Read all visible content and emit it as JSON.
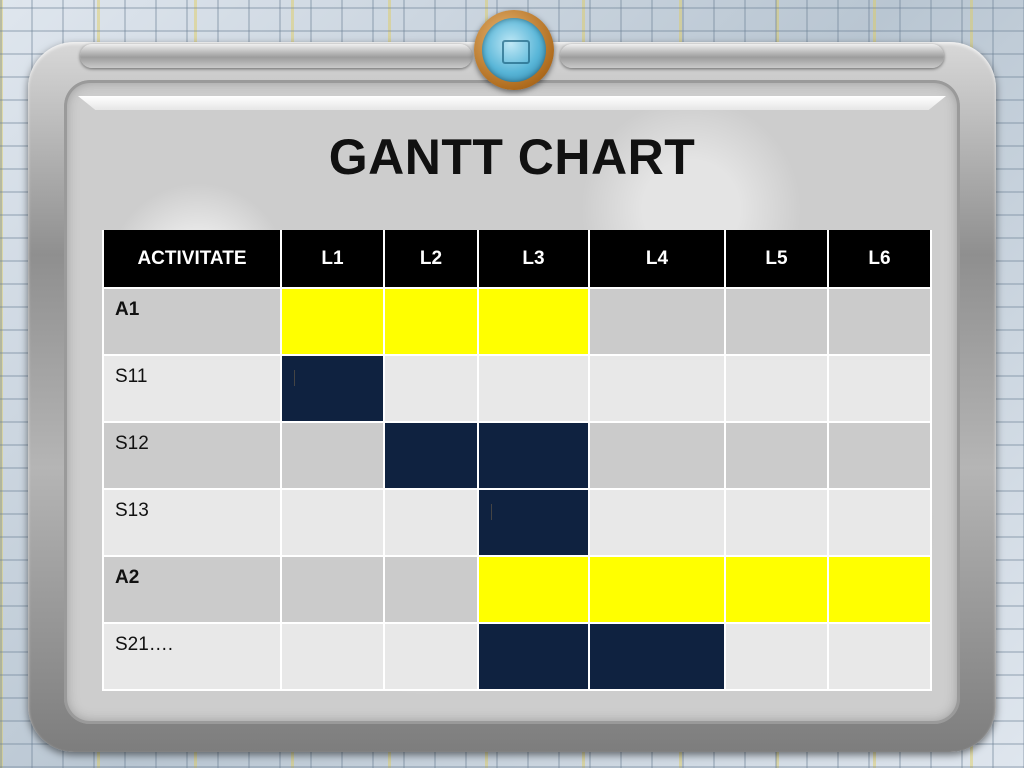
{
  "chart_data": {
    "type": "table",
    "title": "GANTT CHART",
    "columns": [
      "ACTIVITATE",
      "L1",
      "L2",
      "L3",
      "L4",
      "L5",
      "L6"
    ],
    "rows": [
      {
        "label": "A1",
        "bold": true,
        "active": [
          true,
          true,
          true,
          false,
          false,
          false
        ],
        "kind": "summary"
      },
      {
        "label": "S11",
        "bold": false,
        "active": [
          true,
          false,
          false,
          false,
          false,
          false
        ],
        "kind": "task",
        "mark": [
          true,
          false,
          false,
          false,
          false,
          false
        ]
      },
      {
        "label": "S12",
        "bold": false,
        "active": [
          false,
          true,
          true,
          false,
          false,
          false
        ],
        "kind": "task"
      },
      {
        "label": "S13",
        "bold": false,
        "active": [
          false,
          false,
          true,
          false,
          false,
          false
        ],
        "kind": "task",
        "mark": [
          false,
          false,
          true,
          false,
          false,
          false
        ]
      },
      {
        "label": "A2",
        "bold": true,
        "active": [
          false,
          false,
          true,
          true,
          true,
          true
        ],
        "kind": "summary"
      },
      {
        "label": "S21….",
        "bold": false,
        "active": [
          false,
          false,
          true,
          true,
          false,
          false
        ],
        "kind": "task"
      }
    ],
    "colors": {
      "summary_bar": "#ffff00",
      "task_bar": "#0f2240",
      "header_bg": "#000000",
      "row_shaded": "#cbcbcb",
      "row_light": "#e8e8e8"
    }
  }
}
